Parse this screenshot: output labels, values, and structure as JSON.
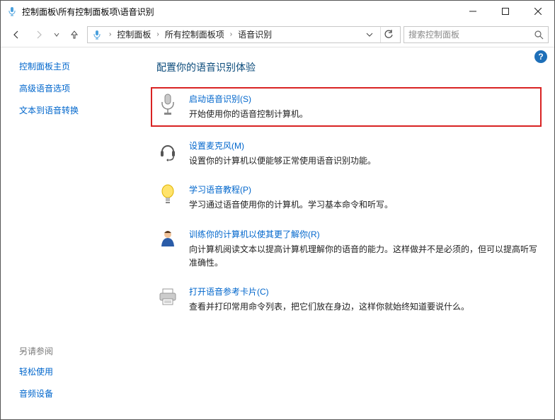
{
  "window": {
    "title": "控制面板\\所有控制面板项\\语音识别"
  },
  "breadcrumbs": {
    "crumb0": "控制面板",
    "crumb1": "所有控制面板项",
    "crumb2": "语音识别"
  },
  "search": {
    "placeholder": "搜索控制面板"
  },
  "sidebar": {
    "home": "控制面板主页",
    "advanced": "高级语音选项",
    "tts": "文本到语音转换"
  },
  "see_also": {
    "heading": "另请参阅",
    "ease": "轻松使用",
    "audio": "音频设备"
  },
  "content": {
    "heading": "配置你的语音识别体验",
    "opt_start": {
      "title": "启动语音识别(S)",
      "desc": "开始使用你的语音控制计算机。"
    },
    "opt_mic": {
      "title": "设置麦克风(M)",
      "desc": "设置你的计算机以便能够正常使用语音识别功能。"
    },
    "opt_tutorial": {
      "title": "学习语音教程(P)",
      "desc": "学习通过语音使用你的计算机。学习基本命令和听写。"
    },
    "opt_train": {
      "title": "训练你的计算机以使其更了解你(R)",
      "desc": "向计算机阅读文本以提高计算机理解你的语音的能力。这样做并不是必须的，但可以提高听写准确性。"
    },
    "opt_ref": {
      "title": "打开语音参考卡片(C)",
      "desc": "查看并打印常用命令列表，把它们放在身边，这样你就始终知道要说什么。"
    }
  }
}
